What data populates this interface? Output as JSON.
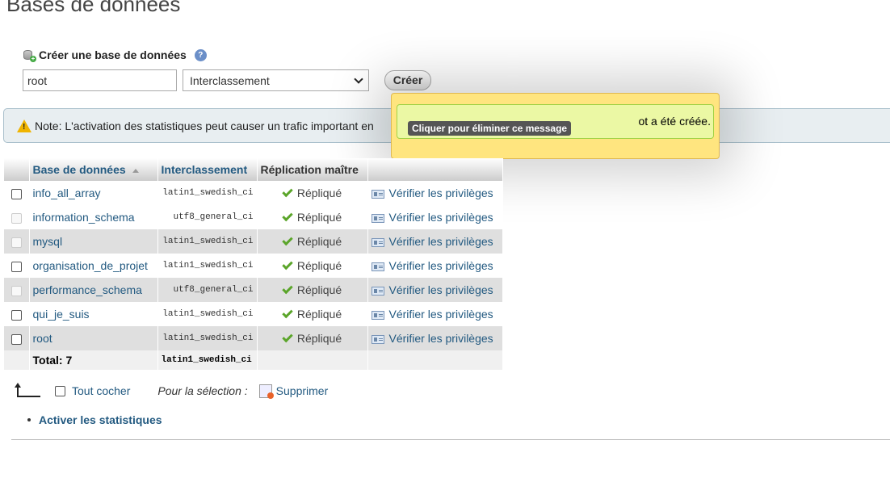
{
  "page": {
    "title": "Bases de données"
  },
  "create": {
    "legend": "Créer une base de données",
    "help_label": "?",
    "dbname_value": "root",
    "collation_selected": "Interclassement",
    "submit_label": "Créer"
  },
  "note": {
    "text": "Note: L'activation des statistiques peut causer un trafic important en"
  },
  "popup": {
    "message": "ot a été créée.",
    "tooltip": "Cliquer pour éliminer ce message"
  },
  "table": {
    "headers": {
      "name": "Base de données",
      "collation": "Interclassement",
      "replication": "Réplication maître"
    },
    "rows": [
      {
        "name": "info_all_array",
        "collation": "latin1_swedish_ci",
        "replication": "Répliqué",
        "privileges": "Vérifier les privilèges"
      },
      {
        "name": "information_schema",
        "collation": "utf8_general_ci",
        "replication": "Répliqué",
        "privileges": "Vérifier les privilèges"
      },
      {
        "name": "mysql",
        "collation": "latin1_swedish_ci",
        "replication": "Répliqué",
        "privileges": "Vérifier les privilèges"
      },
      {
        "name": "organisation_de_projet",
        "collation": "latin1_swedish_ci",
        "replication": "Répliqué",
        "privileges": "Vérifier les privilèges"
      },
      {
        "name": "performance_schema",
        "collation": "utf8_general_ci",
        "replication": "Répliqué",
        "privileges": "Vérifier les privilèges"
      },
      {
        "name": "qui_je_suis",
        "collation": "latin1_swedish_ci",
        "replication": "Répliqué",
        "privileges": "Vérifier les privilèges"
      },
      {
        "name": "root",
        "collation": "latin1_swedish_ci",
        "replication": "Répliqué",
        "privileges": "Vérifier les privilèges"
      }
    ],
    "total_label": "Total: 7",
    "total_collation": "latin1_swedish_ci"
  },
  "bulk": {
    "check_all_label": "Tout cocher",
    "with_selected_label": "Pour la sélection :",
    "delete_label": "Supprimer"
  },
  "stats": {
    "enable_label": "Activer les statistiques"
  },
  "colors": {
    "link": "#235a81",
    "warning": "#f0b400",
    "success": "#5ba52a",
    "popup_bg": "#ffe57f"
  }
}
